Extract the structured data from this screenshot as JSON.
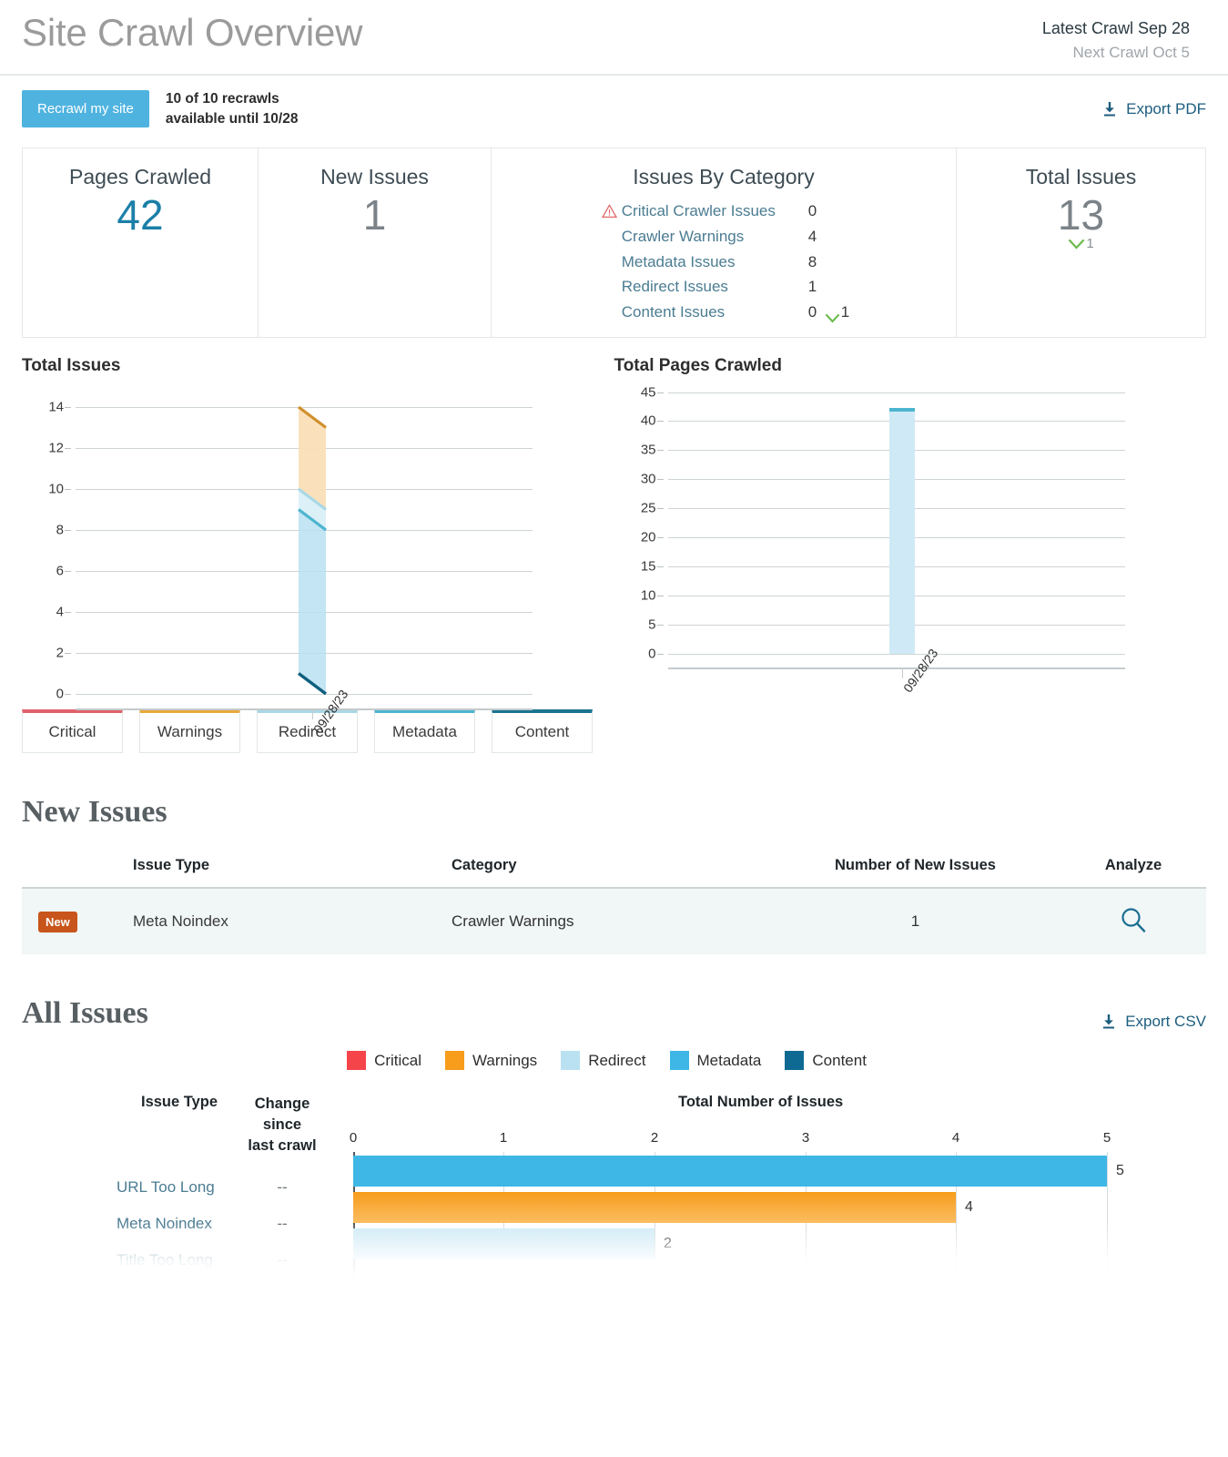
{
  "header": {
    "title": "Site Crawl Overview",
    "latest_crawl": "Latest Crawl Sep 28",
    "next_crawl": "Next Crawl Oct 5"
  },
  "actionbar": {
    "recrawl_button": "Recrawl my site",
    "recrawl_info_line1": "10 of 10 recrawls",
    "recrawl_info_line2": "available until 10/28",
    "export_pdf": "Export PDF"
  },
  "summary": {
    "pages_crawled": {
      "title": "Pages Crawled",
      "value": "42"
    },
    "new_issues": {
      "title": "New Issues",
      "value": "1"
    },
    "issues_by_category": {
      "title": "Issues By Category",
      "rows": [
        {
          "label": "Critical Crawler Issues",
          "value": "0",
          "icon": "warning-triangle-icon",
          "delta": ""
        },
        {
          "label": "Crawler Warnings",
          "value": "4",
          "icon": "",
          "delta": ""
        },
        {
          "label": "Metadata Issues",
          "value": "8",
          "icon": "",
          "delta": ""
        },
        {
          "label": "Redirect Issues",
          "value": "1",
          "icon": "",
          "delta": ""
        },
        {
          "label": "Content Issues",
          "value": "0",
          "icon": "",
          "delta": "1"
        }
      ]
    },
    "total_issues": {
      "title": "Total Issues",
      "value": "13",
      "delta": "1"
    }
  },
  "colors": {
    "critical": "#f5444a",
    "warnings": "#f79c1b",
    "redirect": "#b9e1f2",
    "metadata": "#3eb7e6",
    "content": "#0e6a93",
    "accent_blue": "#4fb3e0",
    "link_blue": "#4b7c92",
    "badge_orange": "#c8551b",
    "delta_green": "#6cbb4d"
  },
  "chart_data": [
    {
      "type": "area",
      "title": "Total Issues",
      "xlabel": "",
      "ylabel": "",
      "categories": [
        "09/28/23"
      ],
      "ylim": [
        0,
        14
      ],
      "yticks": [
        0,
        2,
        4,
        6,
        8,
        10,
        12,
        14
      ],
      "grid": true,
      "stacked": true,
      "series": [
        {
          "name": "Critical",
          "color": "#f5444a",
          "values": [
            0
          ]
        },
        {
          "name": "Warnings",
          "color": "#f79c1b",
          "values": [
            4
          ]
        },
        {
          "name": "Redirect",
          "color": "#b9e1f2",
          "values": [
            1
          ]
        },
        {
          "name": "Metadata",
          "color": "#3eb7e6",
          "values": [
            8
          ]
        },
        {
          "name": "Content",
          "color": "#0e6a93",
          "values": [
            1
          ]
        }
      ]
    },
    {
      "type": "area",
      "title": "Total Pages Crawled",
      "xlabel": "",
      "ylabel": "",
      "categories": [
        "09/28/23"
      ],
      "ylim": [
        0,
        45
      ],
      "yticks": [
        0,
        5,
        10,
        15,
        20,
        25,
        30,
        35,
        40,
        45
      ],
      "grid": true,
      "series": [
        {
          "name": "Pages Crawled",
          "color": "#b9e1f2",
          "values": [
            42
          ]
        }
      ]
    },
    {
      "type": "bar",
      "orientation": "horizontal",
      "title": "Total Number of Issues",
      "xlabel": "Total Number of Issues",
      "ylabel": "Issue Type",
      "categories": [
        "URL Too Long",
        "Meta Noindex",
        "Title Too Long"
      ],
      "values": [
        5,
        4,
        2
      ],
      "xlim": [
        0,
        5
      ],
      "xticks": [
        0,
        1,
        2,
        3,
        4,
        5
      ],
      "bar_colors": [
        "#3eb7e6",
        "#f79c1b",
        "#b9e1f2"
      ],
      "changes": [
        "--",
        "--",
        "--"
      ],
      "data_labels": [
        "5",
        "4",
        "2"
      ]
    }
  ],
  "chart_legend_cards": [
    {
      "label": "Critical",
      "color": "#e0616b"
    },
    {
      "label": "Warnings",
      "color": "#e9a83c"
    },
    {
      "label": "Redirect",
      "color": "#a9d8e6"
    },
    {
      "label": "Metadata",
      "color": "#4cb5cf"
    },
    {
      "label": "Content",
      "color": "#1a7490"
    }
  ],
  "new_issues_section": {
    "heading": "New Issues",
    "columns": [
      "Issue Type",
      "Category",
      "Number of New Issues",
      "Analyze"
    ],
    "rows": [
      {
        "badge": "New",
        "issue_type": "Meta Noindex",
        "category": "Crawler Warnings",
        "count": "1",
        "analyze_icon": "search-icon"
      }
    ]
  },
  "all_issues_section": {
    "heading": "All Issues",
    "export_csv": "Export CSV",
    "legend": [
      {
        "label": "Critical",
        "color": "#f5444a"
      },
      {
        "label": "Warnings",
        "color": "#f79c1b"
      },
      {
        "label": "Redirect",
        "color": "#b9e1f2"
      },
      {
        "label": "Metadata",
        "color": "#3eb7e6"
      },
      {
        "label": "Content",
        "color": "#0e6a93"
      }
    ],
    "columns": {
      "issue_type": "Issue Type",
      "change_line1": "Change since",
      "change_line2": "last crawl",
      "total": "Total Number of Issues"
    }
  }
}
